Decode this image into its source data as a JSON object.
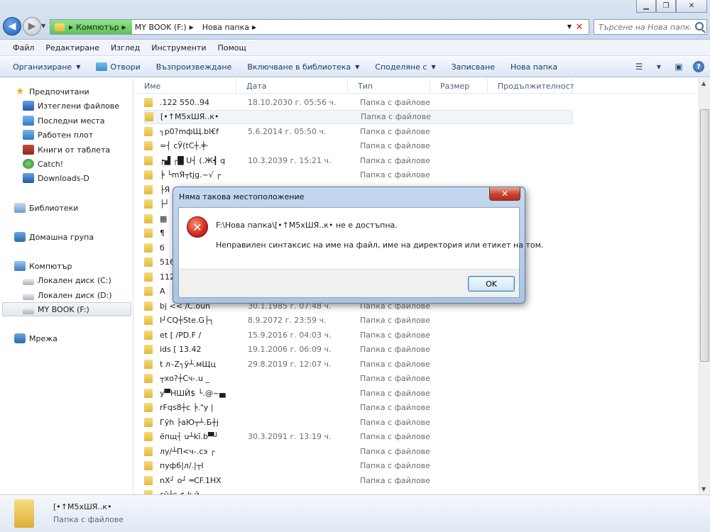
{
  "window": {
    "minimize_glyph": "▁",
    "maximize_glyph": "❐",
    "close_glyph": "✕"
  },
  "address": {
    "crumbs": [
      "Компютър",
      "MY BOOK (F:)",
      "Нова папка"
    ],
    "search_placeholder": "Търсене на Нова папка"
  },
  "menu": [
    "Файл",
    "Редактиране",
    "Изглед",
    "Инструменти",
    "Помощ"
  ],
  "commands": {
    "organize": "Организиране",
    "open": "Отвори",
    "play": "Възпроизвеждане",
    "include_library": "Включване в библиотека",
    "share": "Споделяне с",
    "burn": "Записване",
    "new_folder": "Нова папка"
  },
  "nav": {
    "favorites": "Предпочитани",
    "favorites_items": [
      "Изтеглени файлове",
      "Последни места",
      "Работен плот",
      "Книги от таблета",
      "Catch!",
      "Downloads-D"
    ],
    "libraries": "Библиотеки",
    "homegroup": "Домашна група",
    "computer": "Компютър",
    "computer_items": [
      "Локален диск (C:)",
      "Локален диск (D:)",
      "MY BOOK (F:)"
    ],
    "network": "Мрежа"
  },
  "columns": [
    "Име",
    "Дата",
    "Тип",
    "Размер",
    "Продължителност"
  ],
  "files": [
    {
      "name": ".122 550..94",
      "date": "18.10.2030 г. 05:56 ч.",
      "type": "Папка с файлове"
    },
    {
      "name": "[•↑M5xШЯ..к•",
      "date": "",
      "type": "Папка с файлове"
    },
    {
      "name": "┐p0?mфЩ.bl€f",
      "date": "5.6.2014 г. 05:50 ч.",
      "type": "Папка с файлове"
    },
    {
      "name": "=┤ cЎ(tC┼.╪·",
      "date": "",
      "type": "Папка с файлове"
    },
    {
      "name": "┍▟ ┌█ U┤ (.Ж┫ q",
      "date": "10.3.2039 г. 15:21 ч.",
      "type": "Папка с файлове"
    },
    {
      "name": "╞ └mЯ┬tjg.~√ ┌",
      "date": "",
      "type": "Папка с файлове"
    },
    {
      "name": "├Я",
      "date": "",
      "type": ""
    },
    {
      "name": "├┘",
      "date": "",
      "type": ""
    },
    {
      "name": "▦",
      "date": "",
      "type": ""
    },
    {
      "name": "¶",
      "date": "",
      "type": ""
    },
    {
      "name": "б",
      "date": "",
      "type": ""
    },
    {
      "name": "516",
      "date": "",
      "type": ""
    },
    {
      "name": "112",
      "date": "",
      "type": ""
    },
    {
      "name": "A",
      "date": "",
      "type": ""
    },
    {
      "name": "bj << /C.oun",
      "date": "30.1.1985 г. 07:48 ч.",
      "type": "Папка с файлове"
    },
    {
      "name": "I┘CQ┼Ste.G├┐",
      "date": "8.9.2072 г. 23:59 ч.",
      "type": "Папка с файлове"
    },
    {
      "name": "et [ /PD.F /",
      "date": "15.9.2016 г. 04:03 ч.",
      "type": "Папка с файлове"
    },
    {
      "name": "ids [ 13.42",
      "date": "19.1.2006 г. 06:09 ч.",
      "type": "Папка с файлове"
    },
    {
      "name": "t л–Z┐ў┴.мЩц",
      "date": "29.8.2019 г. 12:07 ч.",
      "type": "Папка с файлове"
    },
    {
      "name": "┬хо?┼Сч-.u _",
      "date": "",
      "type": "Папка с файлове"
    },
    {
      "name": "у▀НШЙ$ └.@~▄",
      "date": "",
      "type": "Папка с файлове"
    },
    {
      "name": "rFqs8┼c ╞.\"у |",
      "date": "",
      "type": "Папка с файлове"
    },
    {
      "name": "Гўh ├аЮ┬┴.Б┼j",
      "date": "",
      "type": "Папка с файлове"
    },
    {
      "name": "ёпщ┤ u┴kĭ.b▀┘",
      "date": "30.3.2091 г. 13:19 ч.",
      "type": "Папка с файлове"
    },
    {
      "name": "лу/┴П<ч-.сэ ┌",
      "date": "",
      "type": "Папка с файлове"
    },
    {
      "name": "пуф6|л/.|┬I",
      "date": "",
      "type": "Папка с файлове"
    },
    {
      "name": "nX┘ о┘ ═CF.1HX",
      "date": "",
      "type": "Папка с файлове"
    },
    {
      "name": "cӯ┼s  ¢.k й",
      "date": "",
      "type": ""
    }
  ],
  "details": {
    "name": "[•↑M5xШЯ..к•",
    "type": "Папка с файлове"
  },
  "dialog": {
    "title": "Няма такова местоположение",
    "close_glyph": "✕",
    "icon_glyph": "✕",
    "line1": "F:\\Нова папка\\[•↑M5xШЯ..к• не е достъпна.",
    "line2": "Неправилен синтаксис на име на файл, име на директория или етикет на том.",
    "ok": "OK"
  }
}
